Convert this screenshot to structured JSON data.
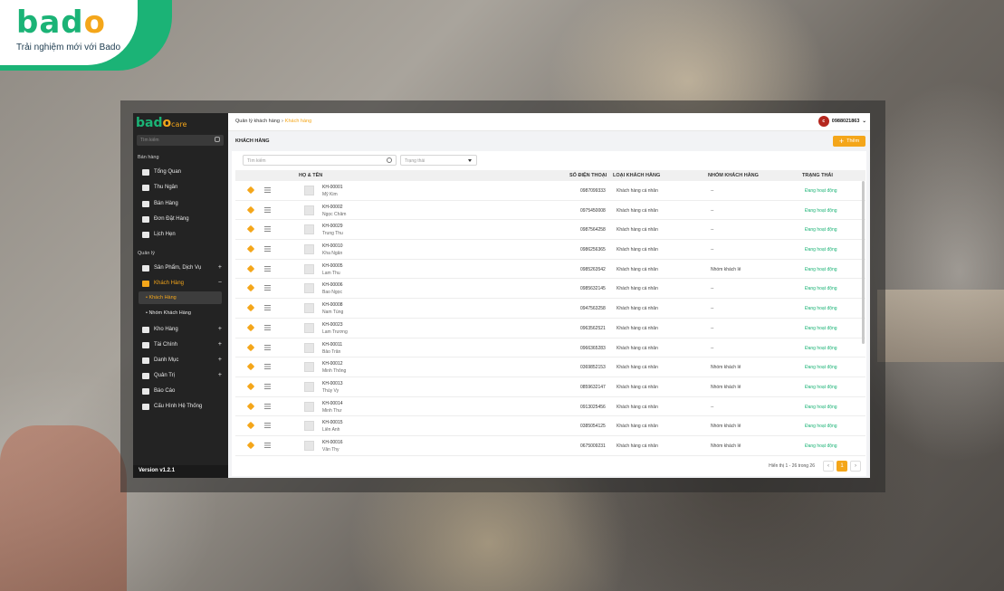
{
  "brand": {
    "logo_letters": [
      "b",
      "a",
      "d",
      "o"
    ],
    "tagline": "Trải nghiệm mới với Bado",
    "colors": {
      "green": "#1bb376",
      "orange": "#f4a61a"
    }
  },
  "app": {
    "logo_letters": [
      "b",
      "a",
      "d",
      "o"
    ],
    "logo_suffix": "care",
    "version": "Version v1.2.1"
  },
  "sidebar": {
    "search_placeholder": "Tìm kiếm",
    "sections": [
      {
        "label": "Bán hàng"
      },
      {
        "label": "Quản lý"
      }
    ],
    "items": [
      {
        "label": "Tổng Quan",
        "icon": "dashboard-icon"
      },
      {
        "label": "Thu Ngân",
        "icon": "cashier-icon"
      },
      {
        "label": "Bán Hàng",
        "icon": "sales-icon"
      },
      {
        "label": "Đơn Đặt Hàng",
        "icon": "order-icon"
      },
      {
        "label": "Lịch Hẹn",
        "icon": "calendar-icon"
      },
      {
        "label": "Sản Phẩm, Dịch Vụ",
        "icon": "product-icon",
        "expand": "+"
      },
      {
        "label": "Khách Hàng",
        "icon": "customers-icon",
        "expand": "−",
        "active": true
      },
      {
        "label": "Kho Hàng",
        "icon": "warehouse-icon",
        "expand": "+"
      },
      {
        "label": "Tài Chính",
        "icon": "finance-icon",
        "expand": "+"
      },
      {
        "label": "Danh Mục",
        "icon": "category-icon",
        "expand": "+"
      },
      {
        "label": "Quản Trị",
        "icon": "admin-icon",
        "expand": "+"
      },
      {
        "label": "Báo Cáo",
        "icon": "report-icon"
      },
      {
        "label": "Cấu Hình Hệ Thống",
        "icon": "settings-icon"
      }
    ],
    "subitems": [
      {
        "label": "• Khách Hàng",
        "active": true
      },
      {
        "label": "• Nhóm Khách Hàng"
      }
    ]
  },
  "topbar": {
    "breadcrumb": [
      "Quản lý khách hàng",
      "Khách hàng"
    ],
    "separator": "›",
    "user_phone": "0988021863",
    "avatar_initial": "c",
    "caret": "⌄"
  },
  "page": {
    "title": "KHÁCH HÀNG",
    "add_label": "Thêm",
    "add_icon": "+",
    "search_placeholder": "Tìm kiếm",
    "status_placeholder": "Trạng thái"
  },
  "table": {
    "headers": [
      "HỌ & TÊN",
      "SỐ ĐIỆN THOẠI",
      "LOẠI KHÁCH HÀNG",
      "NHÓM KHÁCH HÀNG",
      "TRẠNG THÁI"
    ],
    "rows": [
      {
        "code": "KH-00001",
        "name": "Mỹ Kim",
        "phone": "0987099333",
        "type": "Khách hàng cá nhân",
        "group": "--",
        "status": "Đang hoạt động"
      },
      {
        "code": "KH-00002",
        "name": "Ngọc Châm",
        "phone": "0975450008",
        "type": "Khách hàng cá nhân",
        "group": "--",
        "status": "Đang hoạt động"
      },
      {
        "code": "KH-00029",
        "name": "Trung Thu",
        "phone": "0987564258",
        "type": "Khách hàng cá nhân",
        "group": "--",
        "status": "Đang hoạt động"
      },
      {
        "code": "KH-00010",
        "name": "Kha Ngân",
        "phone": "0986256365",
        "type": "Khách hàng cá nhân",
        "group": "--",
        "status": "Đang hoạt động"
      },
      {
        "code": "KH-00005",
        "name": "Lam Thu",
        "phone": "0985263542",
        "type": "Khách hàng cá nhân",
        "group": "Nhóm khách lẻ",
        "status": "Đang hoạt động"
      },
      {
        "code": "KH-00006",
        "name": "Bao Ngọc",
        "phone": "0985632145",
        "type": "Khách hàng cá nhân",
        "group": "--",
        "status": "Đang hoạt động"
      },
      {
        "code": "KH-00008",
        "name": "Nam Tùng",
        "phone": "0947563258",
        "type": "Khách hàng cá nhân",
        "group": "--",
        "status": "Đang hoạt động"
      },
      {
        "code": "KH-00023",
        "name": "Lam Trương",
        "phone": "0963562521",
        "type": "Khách hàng cá nhân",
        "group": "--",
        "status": "Đang hoạt động"
      },
      {
        "code": "KH-00011",
        "name": "Bảo Trân",
        "phone": "0966365283",
        "type": "Khách hàng cá nhân",
        "group": "--",
        "status": "Đang hoạt động"
      },
      {
        "code": "KH-00012",
        "name": "Minh Thông",
        "phone": "0369852153",
        "type": "Khách hàng cá nhân",
        "group": "Nhóm khách lẻ",
        "status": "Đang hoạt động"
      },
      {
        "code": "KH-00013",
        "name": "Thùy Vy",
        "phone": "0859632147",
        "type": "Khách hàng cá nhân",
        "group": "Nhóm khách lẻ",
        "status": "Đang hoạt động"
      },
      {
        "code": "KH-00014",
        "name": "Minh Thư",
        "phone": "0913025456",
        "type": "Khách hàng cá nhân",
        "group": "--",
        "status": "Đang hoạt động"
      },
      {
        "code": "KH-00015",
        "name": "Liên Anh",
        "phone": "0385054125",
        "type": "Khách hàng cá nhân",
        "group": "Nhóm khách lẻ",
        "status": "Đang hoạt động"
      },
      {
        "code": "KH-00016",
        "name": "Vân Thy",
        "phone": "0675009231",
        "type": "Khách hàng cá nhân",
        "group": "Nhóm khách lẻ",
        "status": "Đang hoạt động"
      }
    ]
  },
  "pagination": {
    "info": "Hiển thị 1 - 26 trong 26",
    "prev": "‹",
    "current": "1",
    "next": "›"
  }
}
